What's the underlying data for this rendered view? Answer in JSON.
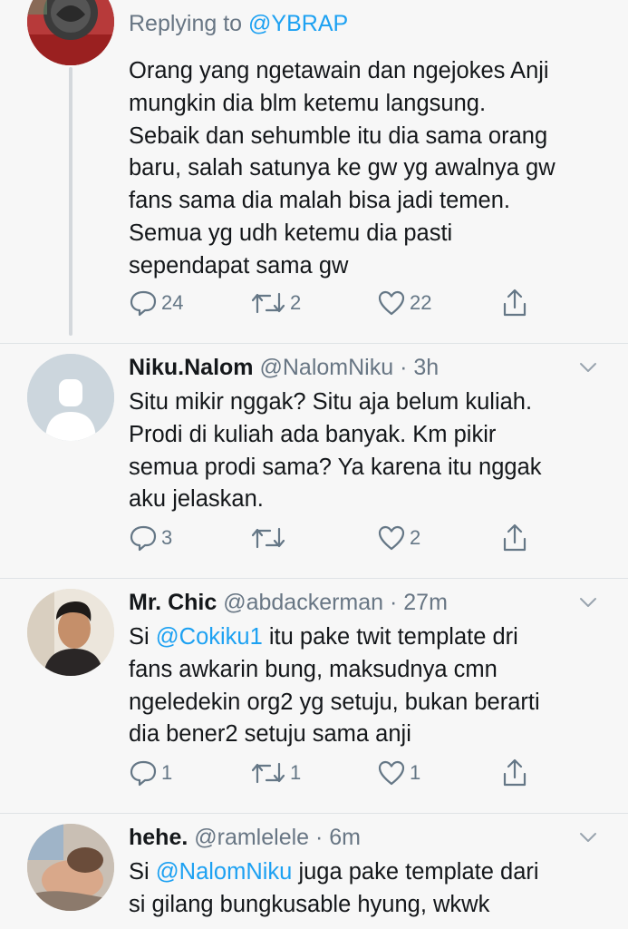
{
  "tweet1": {
    "replying_prefix": "Replying to ",
    "replying_handle": "@YBRAP",
    "text": [
      "Orang yang ngetawain dan ngejokes Anji",
      "mungkin dia blm ketemu langsung.",
      "Sebaik dan sehumble itu dia sama orang",
      "baru, salah satunya ke gw yg awalnya gw",
      "fans sama dia malah bisa jadi temen.",
      "Semua yg udh ketemu dia pasti",
      "sependapat sama gw"
    ],
    "replies": "24",
    "retweets": "2",
    "likes": "22"
  },
  "tweet2": {
    "name": "Niku.Nalom",
    "handle": "@NalomNiku",
    "time": "3h",
    "text": [
      "Situ mikir nggak? Situ aja belum kuliah.",
      "Prodi di kuliah ada banyak. Km pikir",
      "semua prodi sama? Ya karena itu nggak",
      "aku jelaskan."
    ],
    "replies": "3",
    "retweets": "",
    "likes": "2"
  },
  "tweet3": {
    "name": "Mr. Chic",
    "handle": "@abdackerman",
    "time": "27m",
    "line1_prefix": "Si ",
    "line1_mention": "@Cokiku1",
    "line1_suffix": " itu pake twit template dri",
    "text_rest": [
      "fans awkarin bung, maksudnya cmn",
      "ngeledekin org2 yg setuju, bukan berarti",
      "dia bener2 setuju sama anji"
    ],
    "replies": "1",
    "retweets": "1",
    "likes": "1"
  },
  "tweet4": {
    "name": "hehe.",
    "handle": "@ramlelele",
    "time": "6m",
    "line1_prefix": "Si ",
    "line1_mention": "@NalomNiku",
    "line1_suffix": " juga pake template dari",
    "text_rest": [
      "si gilang bungkusable hyung, wkwk"
    ]
  },
  "separator": " · ",
  "icons": {
    "reply": "reply-icon",
    "retweet": "retweet-icon",
    "like": "heart-icon",
    "share": "share-icon",
    "caret": "chevron-down-icon"
  },
  "colors": {
    "accent": "#1da1f2",
    "muted": "#687684",
    "background": "#f7f7f7"
  }
}
